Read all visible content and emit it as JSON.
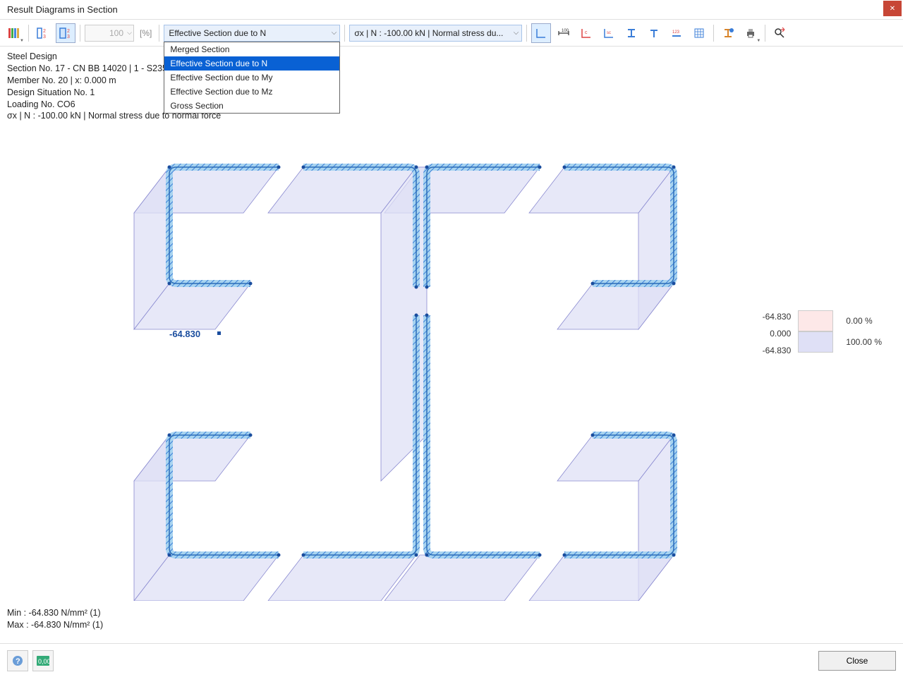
{
  "window": {
    "title": "Result Diagrams in Section"
  },
  "toolbar": {
    "zoom": "100",
    "pct1": "[%]",
    "section_select": "Effective Section due to N",
    "section_options": {
      "o1": "Merged Section",
      "o2": "Effective Section due to N",
      "o3": "Effective Section due to My",
      "o4": "Effective Section due to Mz",
      "o5": "Gross Section"
    },
    "stress_select": "σx | N : -100.00 kN | Normal stress du...",
    "pct2": "[%]"
  },
  "info": {
    "l1": "Steel Design",
    "l2": "Section No. 17 - CN BB 14020 | 1 - S235",
    "l3": "Member No. 20 | x: 0.000 m",
    "l4": "Design Situation No. 1",
    "l5": "Loading No. CO6",
    "l6": "σx | N : -100.00 kN | Normal stress due to normal force"
  },
  "diagram": {
    "label": "-64.830"
  },
  "legend": {
    "v1": "-64.830",
    "v2": "0.000",
    "v3": "-64.830",
    "p1": "0.00 %",
    "p2": "100.00 %"
  },
  "minmax": {
    "min": "Min : -64.830 N/mm² (1)",
    "max": "Max : -64.830 N/mm² (1)"
  },
  "footer": {
    "close": "Close"
  }
}
